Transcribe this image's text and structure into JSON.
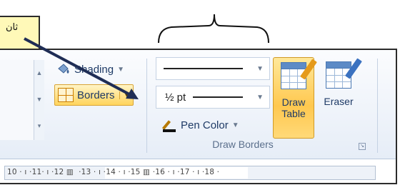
{
  "callout": {
    "text": "ثان"
  },
  "ribbon": {
    "shading": {
      "label": "Shading",
      "icon": "paint-bucket-icon"
    },
    "borders": {
      "label": "Borders",
      "icon": "borders-grid-icon"
    },
    "line_weight": {
      "value": "½ pt"
    },
    "pen_color": {
      "label": "Pen Color",
      "icon": "pen-color-icon"
    },
    "draw_table": {
      "label_line1": "Draw",
      "label_line2": "Table",
      "icon": "draw-table-icon"
    },
    "eraser": {
      "label": "Eraser",
      "icon": "eraser-icon"
    },
    "group_label": "Draw Borders"
  },
  "ruler": {
    "text": "10 · ı ·11· ı ·12 ▥  ·13 · ı ·14 · ı ·15 ▥ ·16 · ı ·17 · ı ·18 ·"
  },
  "colors": {
    "highlight": "#ffc84f",
    "callout_bg": "#fff9b8",
    "arrow": "#1f2d55"
  }
}
